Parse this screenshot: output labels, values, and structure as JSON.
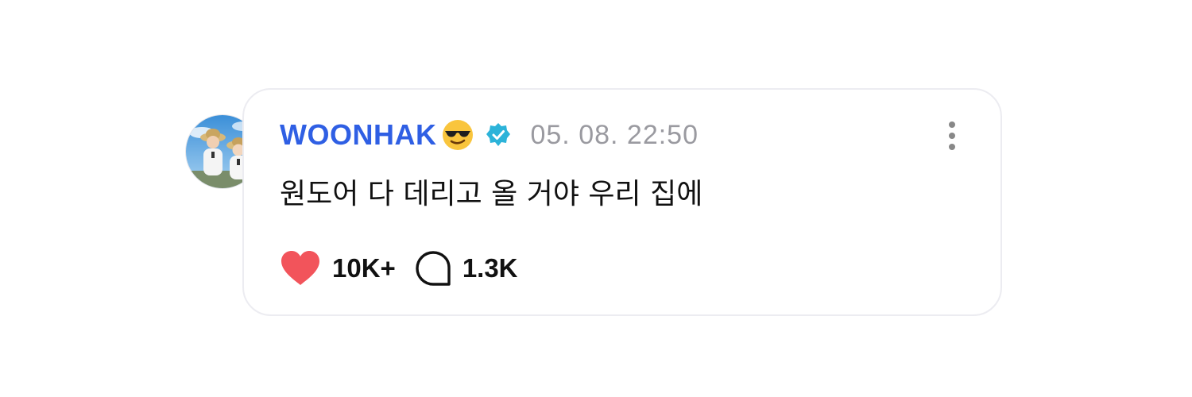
{
  "post": {
    "username": "WOONHAK",
    "username_emoji_icon": "sunglasses-emoji-icon",
    "verified_icon": "verified-badge-icon",
    "timestamp": "05. 08. 22:50",
    "message": "원도어 다 데리고 올 거야 우리 집에",
    "likes": {
      "icon": "heart-icon",
      "count": "10K+"
    },
    "comments": {
      "icon": "speech-bubble-icon",
      "count": "1.3K"
    },
    "more_icon": "more-vertical-icon"
  },
  "colors": {
    "username": "#2f5fe4",
    "verified": "#2cb3d9",
    "heart": "#f2545b",
    "timestamp": "#9a9aa0",
    "card_border": "#ececf1"
  }
}
